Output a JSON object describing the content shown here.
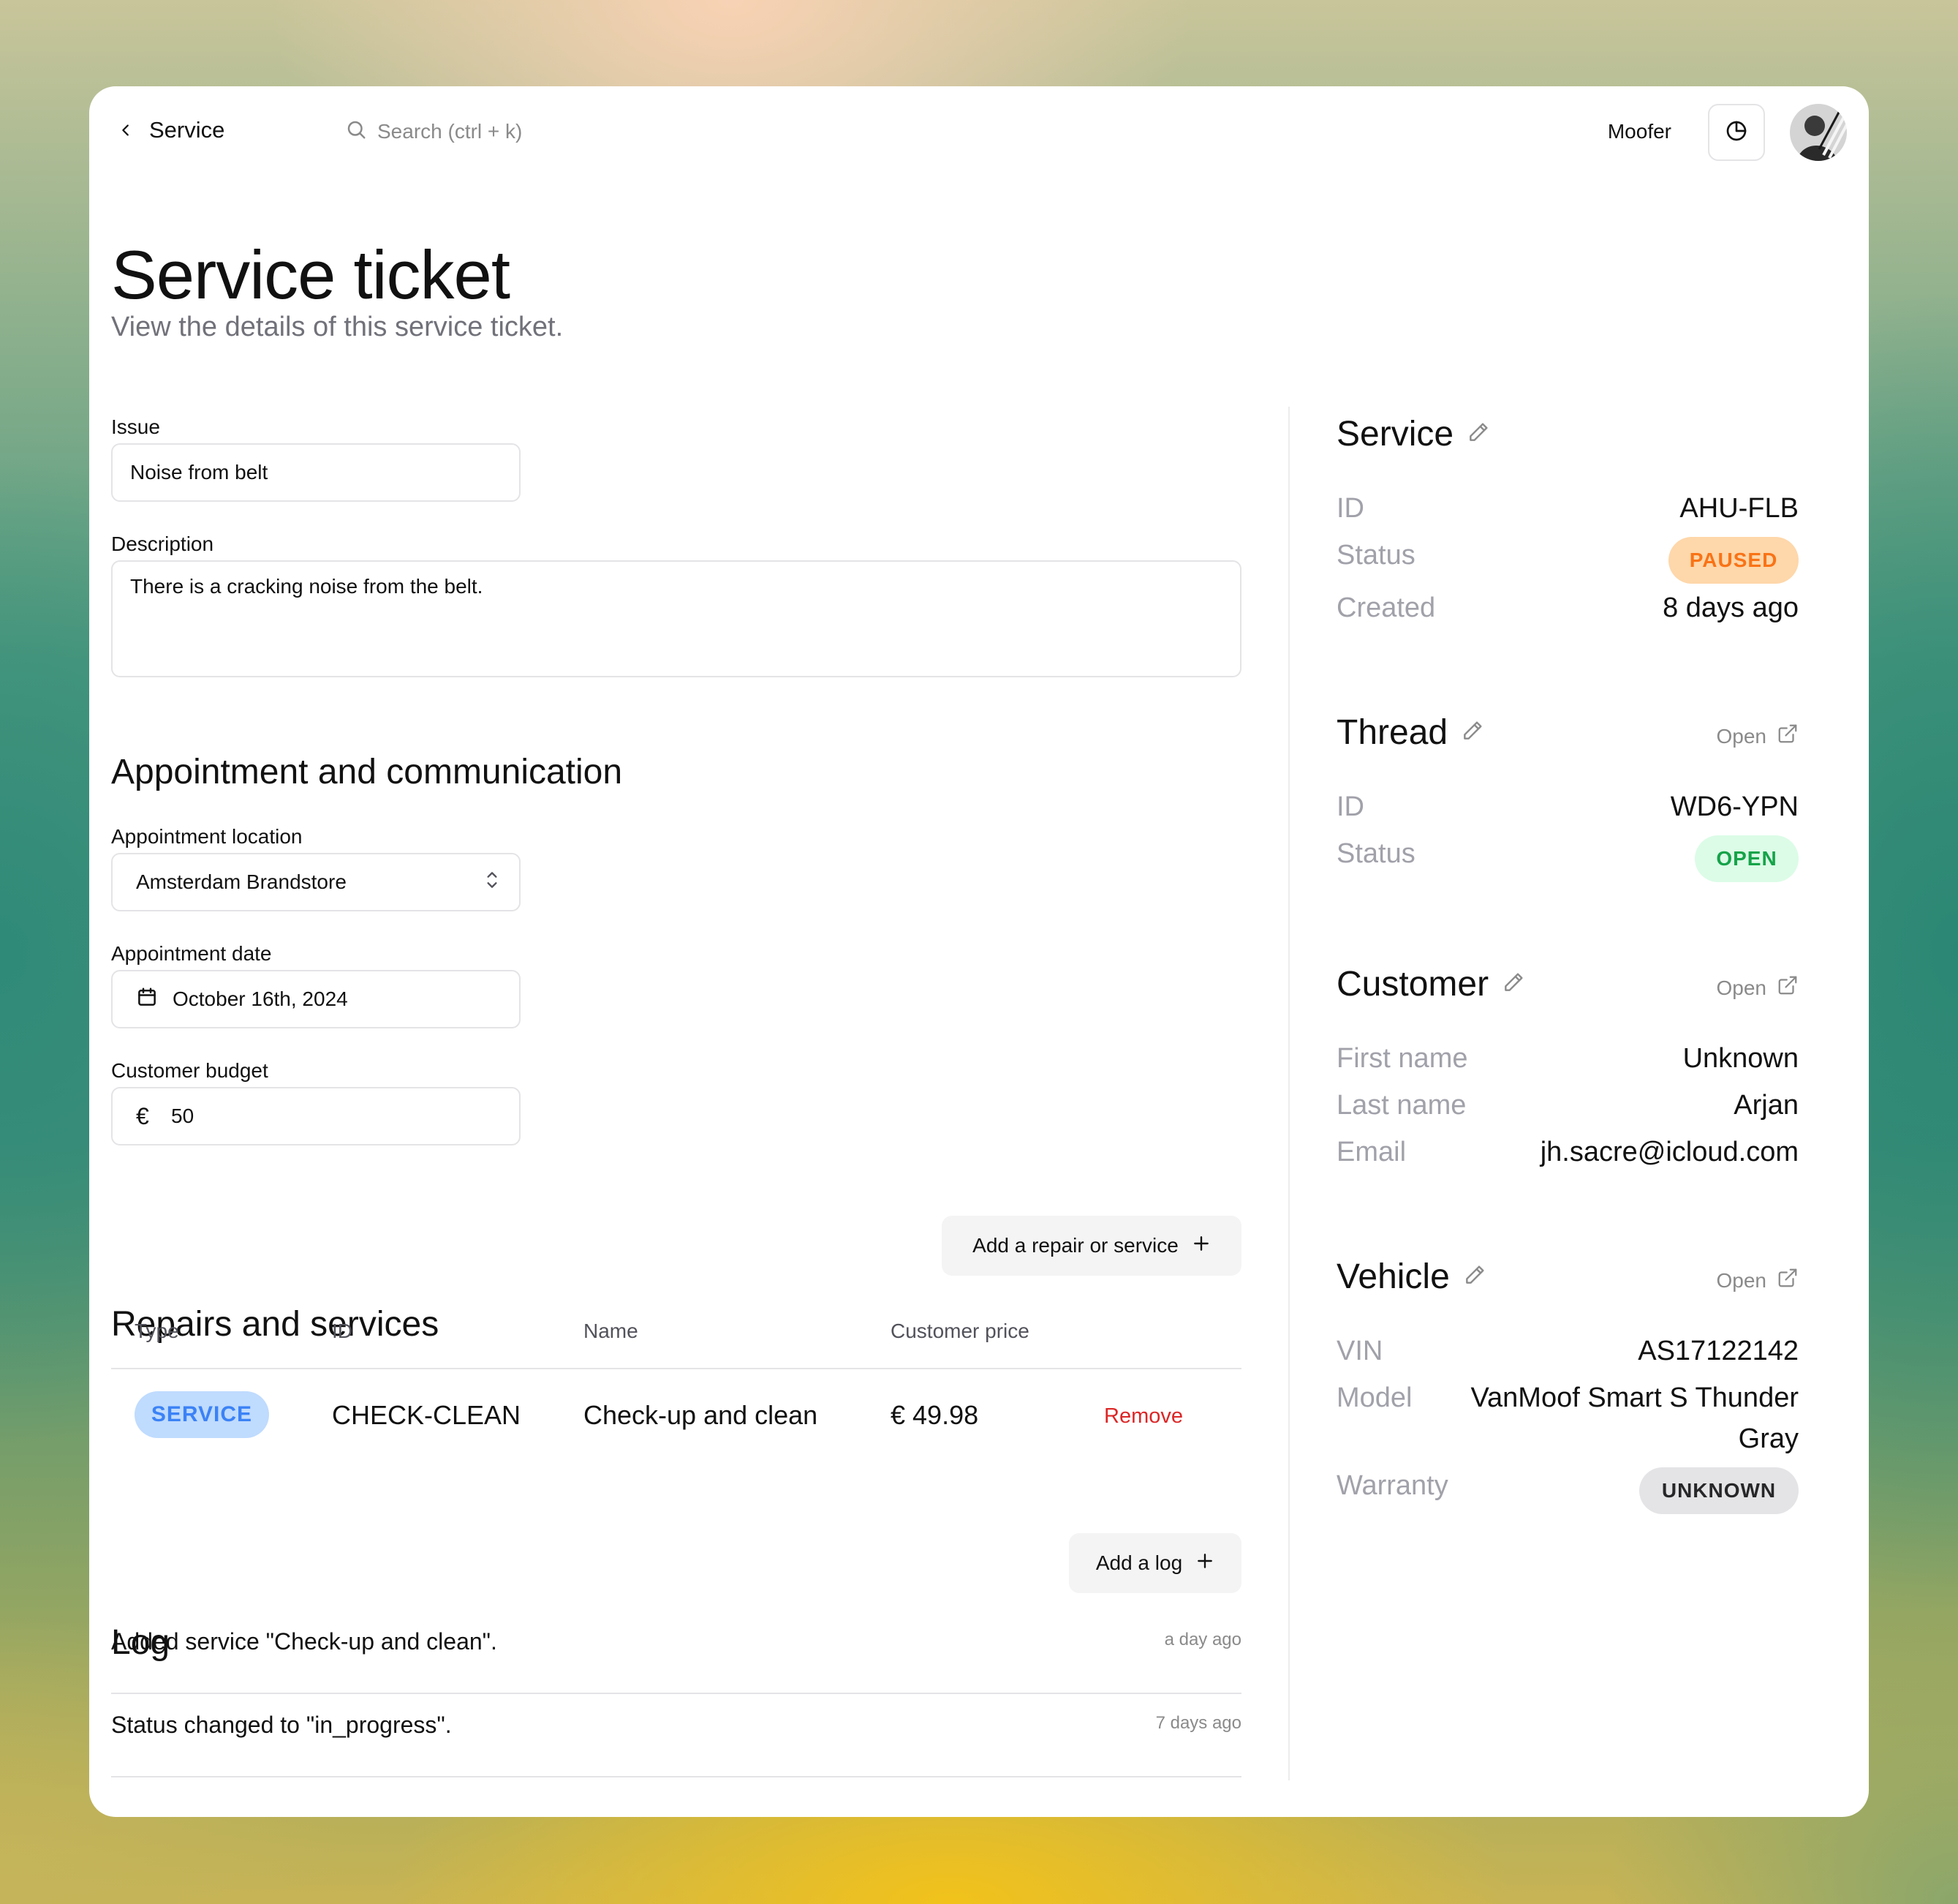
{
  "nav": {
    "back_label": "Service",
    "search_placeholder": "Search (ctrl + k)",
    "org_name": "Moofer"
  },
  "header": {
    "title": "Service ticket",
    "subtitle": "View the details of this service ticket."
  },
  "form": {
    "issue_label": "Issue",
    "issue_value": "Noise from belt",
    "description_label": "Description",
    "description_value": "There is a cracking noise from the belt."
  },
  "appointment": {
    "section_title": "Appointment and communication",
    "location_label": "Appointment location",
    "location_value": "Amsterdam Brandstore",
    "date_label": "Appointment date",
    "date_value": "October 16th, 2024",
    "budget_label": "Customer budget",
    "budget_currency": "€",
    "budget_value": "50"
  },
  "repairs": {
    "section_title": "Repairs and services",
    "add_button": "Add a repair or service",
    "columns": [
      "Type",
      "ID",
      "Name",
      "Customer price"
    ],
    "rows": [
      {
        "type": "SERVICE",
        "id": "CHECK-CLEAN",
        "name": "Check-up and clean",
        "price": "€ 49.98",
        "action": "Remove"
      }
    ]
  },
  "log": {
    "section_title": "Log",
    "add_button": "Add a log",
    "entries": [
      {
        "text": "Added service \"Check-up and clean\".",
        "time": "a day ago"
      },
      {
        "text": "Status changed to \"in_progress\".",
        "time": "7 days ago"
      }
    ]
  },
  "service_panel": {
    "title": "Service",
    "id_label": "ID",
    "id_value": "AHU-FLB",
    "status_label": "Status",
    "status_value": "PAUSED",
    "created_label": "Created",
    "created_value": "8 days ago"
  },
  "thread_panel": {
    "title": "Thread",
    "open_label": "Open",
    "id_label": "ID",
    "id_value": "WD6-YPN",
    "status_label": "Status",
    "status_value": "OPEN"
  },
  "customer_panel": {
    "title": "Customer",
    "open_label": "Open",
    "first_name_label": "First name",
    "first_name_value": "Unknown",
    "last_name_label": "Last name",
    "last_name_value": "Arjan",
    "email_label": "Email",
    "email_value": "jh.sacre@icloud.com"
  },
  "vehicle_panel": {
    "title": "Vehicle",
    "open_label": "Open",
    "vin_label": "VIN",
    "vin_value": "AS17122142",
    "model_label": "Model",
    "model_value_line1": "VanMoof Smart S Thunder",
    "model_value_line2": "Gray",
    "warranty_label": "Warranty",
    "warranty_value": "UNKNOWN"
  },
  "colors": {
    "paused_bg": "#fed7aa",
    "paused_fg": "#f97316",
    "open_bg": "#dcfce7",
    "open_fg": "#16a34a",
    "service_badge_bg": "#bfdbfe",
    "service_badge_fg": "#3b82f6",
    "remove": "#dc2626"
  },
  "icons": [
    "chevron-left-icon",
    "search-icon",
    "pie-chart-icon",
    "calendar-icon",
    "euro-icon",
    "chevron-updown-icon",
    "plus-icon",
    "pencil-icon",
    "external-link-icon"
  ]
}
